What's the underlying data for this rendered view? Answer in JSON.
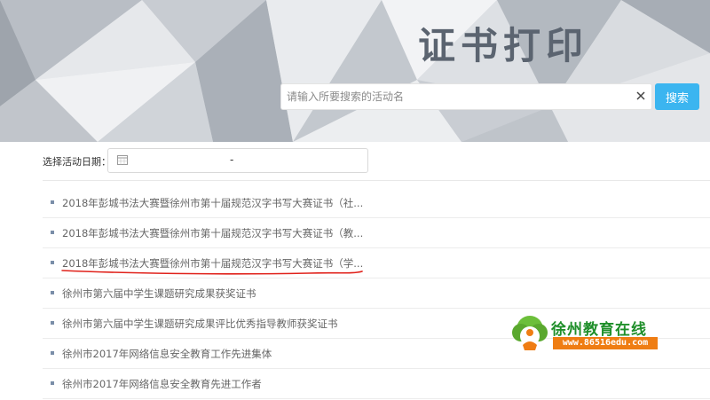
{
  "header": {
    "title": "证书打印"
  },
  "search": {
    "placeholder": "请输入所要搜索的活动名",
    "value": "",
    "button_label": "搜索",
    "clear_icon": "close-icon"
  },
  "filter": {
    "label": "选择活动日期：",
    "date_separator": "-",
    "calendar_icon": "calendar-icon"
  },
  "activities": [
    "2018年彭城书法大赛暨徐州市第十届规范汉字书写大赛证书（社...",
    "2018年彭城书法大赛暨徐州市第十届规范汉字书写大赛证书（教...",
    "2018年彭城书法大赛暨徐州市第十届规范汉字书写大赛证书（学...",
    "徐州市第六届中学生课题研究成果获奖证书",
    "徐州市第六届中学生课题研究成果评比优秀指导教师获奖证书",
    "徐州市2017年网络信息安全教育工作先进集体",
    "徐州市2017年网络信息安全教育先进工作者"
  ],
  "highlighted_index": 2,
  "watermark": {
    "title": "徐州教育在线",
    "url": "www.86516edu.com"
  },
  "colors": {
    "accent": "#3bb5f0",
    "highlight_underline": "#e0221b",
    "watermark_green": "#1f8f2a",
    "watermark_orange": "#ef7d13"
  }
}
